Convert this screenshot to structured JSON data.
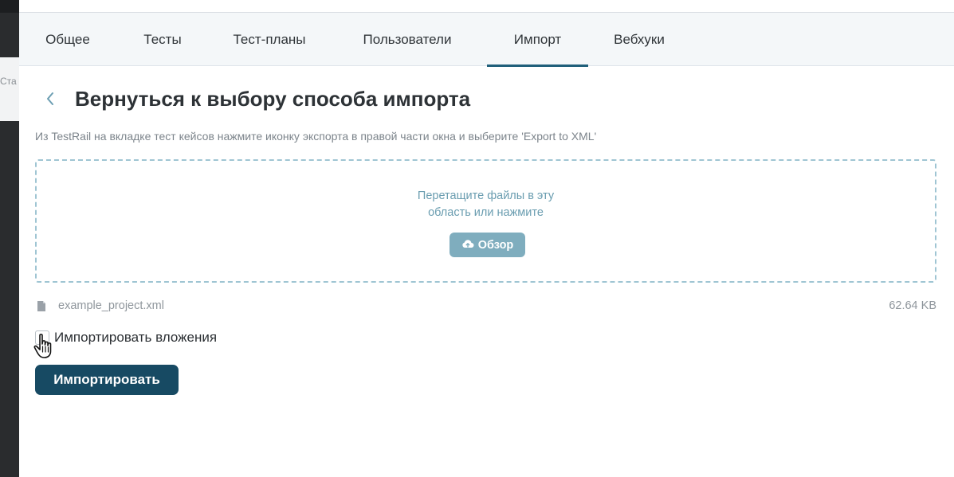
{
  "background": {
    "behind_text": "Ста"
  },
  "tabs": [
    {
      "label": "Общее",
      "active": false
    },
    {
      "label": "Тесты",
      "active": false
    },
    {
      "label": "Тест-планы",
      "active": false
    },
    {
      "label": "Пользователи",
      "active": false
    },
    {
      "label": "Импорт",
      "active": true
    },
    {
      "label": "Вебхуки",
      "active": false
    }
  ],
  "header": {
    "back_icon": "chevron-left-icon",
    "title": "Вернуться к выбору способа импорта"
  },
  "hint": "Из TestRail на вкладке тест кейсов нажмите иконку экспорта в правой части окна и выберите 'Export to XML'",
  "dropzone": {
    "line1": "Перетащите файлы в эту",
    "line2": "область или нажмите",
    "browse_label": "Обзор",
    "browse_icon": "cloud-upload-icon"
  },
  "file": {
    "icon": "document-icon",
    "name": "example_project.xml",
    "size": "62.64 KB"
  },
  "attachments_option": {
    "label": "Импортировать вложения",
    "checked": false
  },
  "import_button": {
    "label": "Импортировать"
  },
  "colors": {
    "accent": "#1f5f7a",
    "primary_button": "#174a63",
    "browse_button": "#7fadbe",
    "dropzone_border": "#9fc5d3"
  }
}
